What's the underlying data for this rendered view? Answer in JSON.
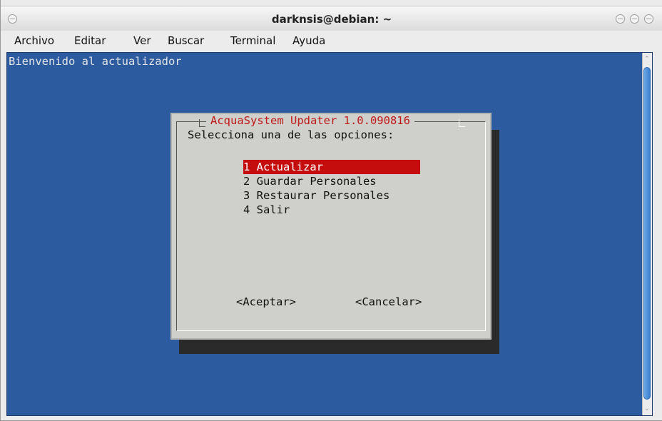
{
  "window": {
    "title": "darknsis@debian: ~"
  },
  "menu": [
    "Archivo",
    "Editar",
    "Ver",
    "Buscar",
    "Terminal",
    "Ayuda"
  ],
  "terminal": {
    "welcome": "Bienvenido al actualizador"
  },
  "dialog": {
    "title": "AcquaSystem Updater 1.0.090816",
    "prompt": "Selecciona una de las opciones:",
    "options": [
      "1 Actualizar",
      "2 Guardar Personales",
      "3 Restaurar Personales",
      "4 Salir"
    ],
    "selected_index": 0,
    "accept": "<Aceptar>",
    "cancel": "<Cancelar>"
  },
  "colors": {
    "terminal_bg": "#2c5ba0",
    "dialog_bg": "#cfcfcb",
    "highlight": "#c60d0d",
    "title_text": "#c01818"
  }
}
